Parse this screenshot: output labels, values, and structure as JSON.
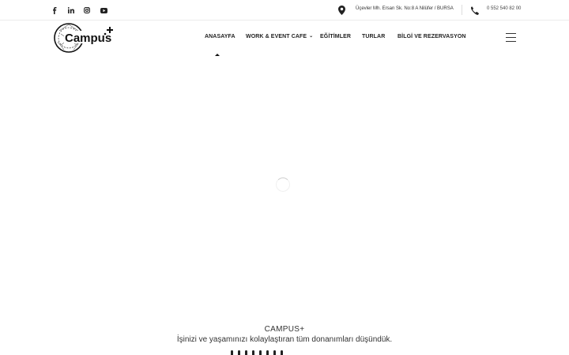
{
  "topbar": {
    "social": [
      {
        "name": "facebook-icon"
      },
      {
        "name": "linkedin-icon"
      },
      {
        "name": "instagram-icon"
      },
      {
        "name": "youtube-icon"
      }
    ],
    "address": "Üçevler Mh. Ersan Sk. No:8 A Nilüfer / BURSA",
    "phone": "0 552 540 82 00"
  },
  "header": {
    "logo_text": "Campus",
    "nav": [
      {
        "label": "ANASAYFA",
        "active": true
      },
      {
        "label": "WORK & EVENT CAFE",
        "has_dropdown": true
      },
      {
        "label": "EĞİTİMLER"
      },
      {
        "label": "TURLAR"
      },
      {
        "label": "BİLGİ VE REZERVASYON"
      }
    ],
    "menu_icon": "hamburger-menu-icon"
  },
  "main": {
    "loader_icon": "loading-spinner-icon",
    "brand": "CAMPUS+",
    "tagline": "İşinizi ve yaşamınızı kolaylaştıran tüm donanımları düşündük."
  },
  "colors": {
    "text": "#222222",
    "border": "#ececec"
  }
}
